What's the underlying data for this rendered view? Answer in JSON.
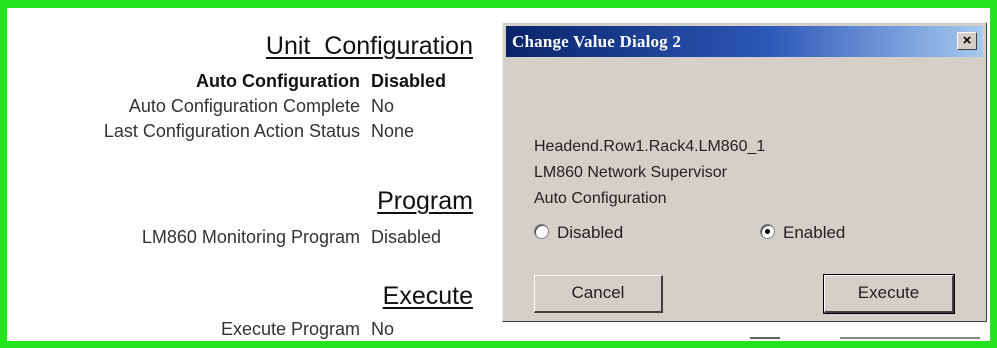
{
  "unit_configuration": {
    "title": "Unit_Configuration",
    "rows": [
      {
        "label": "Auto Configuration",
        "value": "Disabled",
        "bold": true
      },
      {
        "label": "Auto Configuration Complete",
        "value": "No"
      },
      {
        "label": "Last Configuration Action Status",
        "value": "None"
      }
    ]
  },
  "program": {
    "title": "Program",
    "rows": [
      {
        "label": "LM860 Monitoring Program",
        "value": "Disabled"
      }
    ]
  },
  "execute": {
    "title": "Execute",
    "rows": [
      {
        "label": "Execute Program",
        "value": "No"
      }
    ]
  },
  "dialog": {
    "title": "Change Value Dialog 2",
    "close_label": "×",
    "lines": [
      "Headend.Row1.Rack4.LM860_1",
      "LM860 Network Supervisor",
      "Auto Configuration"
    ],
    "options": [
      {
        "label": "Disabled",
        "selected": false
      },
      {
        "label": "Enabled",
        "selected": true
      }
    ],
    "cancel_label": "Cancel",
    "execute_label": "Execute"
  },
  "colors": {
    "frame": "#22e51c",
    "titlebar_start": "#0a246a",
    "titlebar_end": "#a6caf0",
    "dialog_bg": "#d4d0c8"
  }
}
